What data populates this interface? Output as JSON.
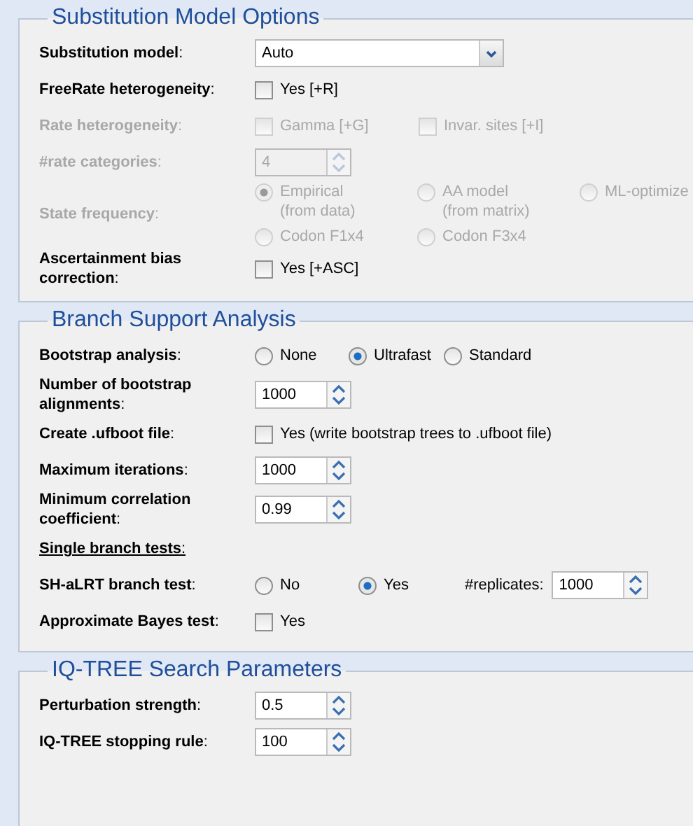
{
  "sections": [
    {
      "title": "Substitution Model Options",
      "rows": [
        {
          "kind": "select",
          "label": "**Substitution model**:",
          "disabled": false,
          "value": "Auto"
        },
        {
          "kind": "checks",
          "label": "**FreeRate heterogeneity**:",
          "disabled": false,
          "options": [
            {
              "label": "Yes [+R]",
              "checked": false
            }
          ]
        },
        {
          "kind": "checks",
          "label": "**Rate heterogeneity**:",
          "disabled": true,
          "options": [
            {
              "label": "Gamma [+G]",
              "checked": false
            },
            {
              "label": "Invar. sites [+I]",
              "checked": false
            }
          ]
        },
        {
          "kind": "spinner",
          "label": "**#rate categories**:",
          "disabled": true,
          "value": "4"
        },
        {
          "kind": "radio_grid",
          "label": "**State frequency**:",
          "disabled": true,
          "options": [
            {
              "label": "Empirical\n(from data)",
              "selected": true
            },
            {
              "label": "AA model\n(from matrix)",
              "selected": false
            },
            {
              "label": "ML-optimize",
              "selected": false
            },
            {
              "label": "Codon F1x4",
              "selected": false
            },
            {
              "label": "Codon F3x4",
              "selected": false
            }
          ]
        },
        {
          "kind": "checks",
          "label": "**Ascertainment bias correction**:",
          "disabled": false,
          "options": [
            {
              "label": "Yes [+ASC]",
              "checked": false
            }
          ]
        }
      ]
    },
    {
      "title": "Branch Support Analysis",
      "rows": [
        {
          "kind": "radios",
          "label": "**Bootstrap analysis**:",
          "disabled": false,
          "options": [
            {
              "label": "None",
              "selected": false
            },
            {
              "label": "Ultrafast",
              "selected": true
            },
            {
              "label": "Standard",
              "selected": false
            }
          ]
        },
        {
          "kind": "spinner",
          "label": "**Number of bootstrap alignments**:",
          "disabled": false,
          "value": "1000"
        },
        {
          "kind": "checks",
          "label": "**Create .ufboot file**:",
          "disabled": false,
          "options": [
            {
              "label": "Yes (write bootstrap trees to .ufboot file)",
              "checked": false
            }
          ]
        },
        {
          "kind": "spinner",
          "label": "**Maximum iterations**:",
          "disabled": false,
          "value": "1000"
        },
        {
          "kind": "spinner",
          "label": "**Minimum correlation coefficient**:",
          "disabled": false,
          "value": "0.99"
        },
        {
          "kind": "heading",
          "label": "**Single branch tests**:",
          "disabled": false
        },
        {
          "kind": "radios_spinner",
          "label": "**SH-aLRT branch test**:",
          "disabled": false,
          "options": [
            {
              "label": "No",
              "selected": false
            },
            {
              "label": "Yes",
              "selected": true
            }
          ],
          "spinner_label": "#replicates:",
          "value": "1000"
        },
        {
          "kind": "checks",
          "label": "**Approximate Bayes test**:",
          "disabled": false,
          "options": [
            {
              "label": "Yes",
              "checked": false
            }
          ]
        }
      ]
    },
    {
      "title": "IQ-TREE Search Parameters",
      "rows": [
        {
          "kind": "spinner",
          "label": "**Perturbation strength**:",
          "disabled": false,
          "value": "0.5"
        },
        {
          "kind": "spinner",
          "label": "**IQ-TREE stopping rule**:",
          "disabled": false,
          "value": "100"
        }
      ]
    }
  ]
}
